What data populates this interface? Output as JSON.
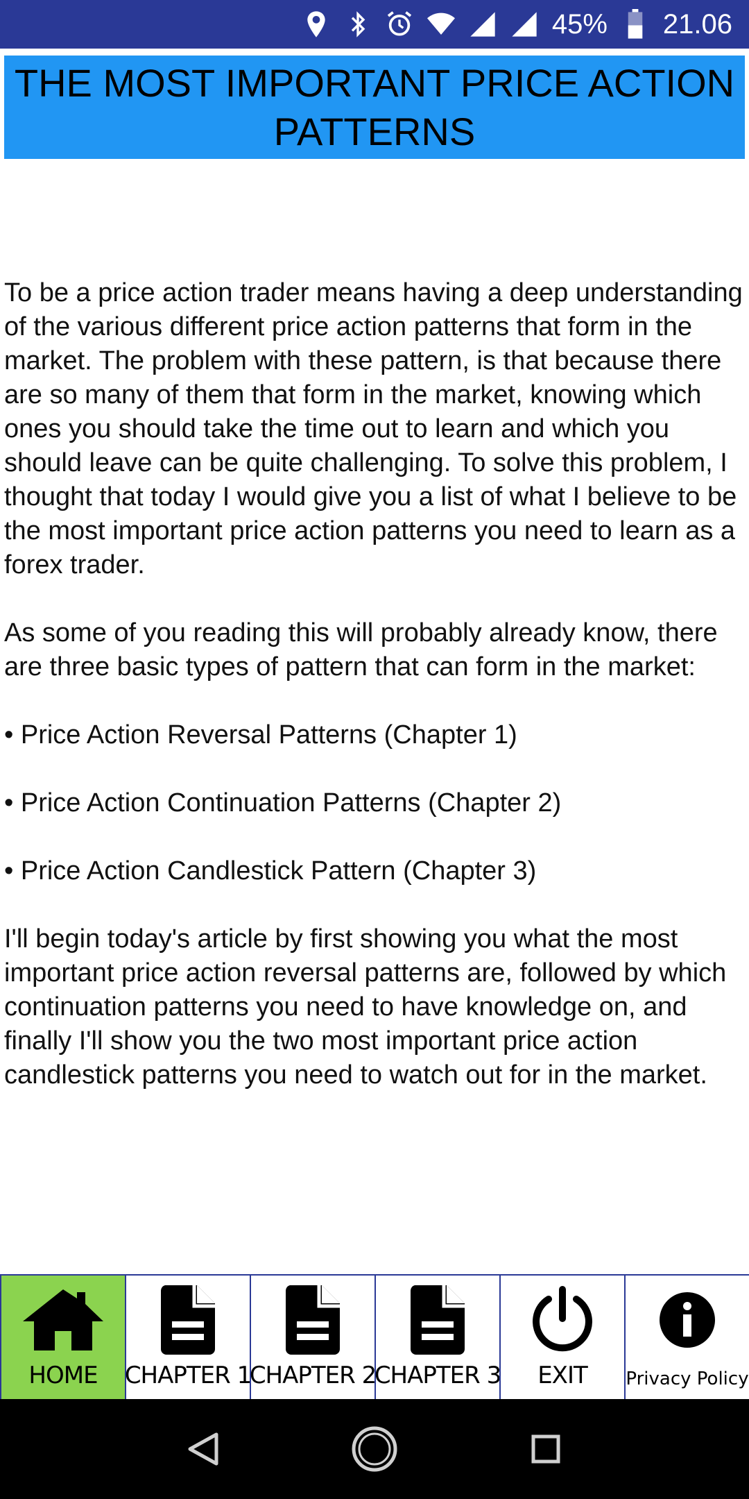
{
  "status_bar": {
    "battery_text": "45%",
    "time": "21.06",
    "icons": [
      "location-icon",
      "bluetooth-icon",
      "alarm-icon",
      "wifi-icon",
      "signal-icon",
      "signal-icon",
      "battery-icon"
    ]
  },
  "title": "THE MOST IMPORTANT PRICE ACTION PATTERNS",
  "article": {
    "paragraph_1": "To be a price action trader means having a deep understanding of the various different price action patterns that form in the market. The problem with these pattern, is that because there are so many of them that form in the market, knowing which ones you should take the time out to learn and which you should leave can be quite challenging. To solve this problem, I thought that today I would give you a list of what I believe to be the most important price action patterns you need to learn as a forex trader.",
    "paragraph_2": "As some of you reading this will probably already know, there are three basic types of pattern that can form in the market:",
    "bullets": [
      "• Price Action Reversal Patterns (Chapter 1)",
      "• Price Action Continuation Patterns (Chapter 2)",
      "• Price Action Candlestick Pattern (Chapter 3)"
    ],
    "paragraph_3": "I'll begin today's article by first showing you what the most important price action reversal patterns are, followed by which continuation patterns you need to have knowledge on, and finally I'll show you the two most important price action candlestick patterns you need to watch out for in the market."
  },
  "bottom_nav": {
    "items": [
      {
        "label": "HOME",
        "icon": "home-icon",
        "active": true
      },
      {
        "label": "CHAPTER 1",
        "icon": "document-icon"
      },
      {
        "label": "CHAPTER 2",
        "icon": "document-icon"
      },
      {
        "label": "CHAPTER 3",
        "icon": "document-icon"
      },
      {
        "label": "EXIT",
        "icon": "power-icon"
      },
      {
        "label": "Privacy Policy",
        "icon": "info-icon"
      }
    ]
  },
  "colors": {
    "status_bar": "#2a3996",
    "title_bg": "#2196f3",
    "nav_active": "#8bd34f",
    "nav_border": "#2a3996"
  }
}
